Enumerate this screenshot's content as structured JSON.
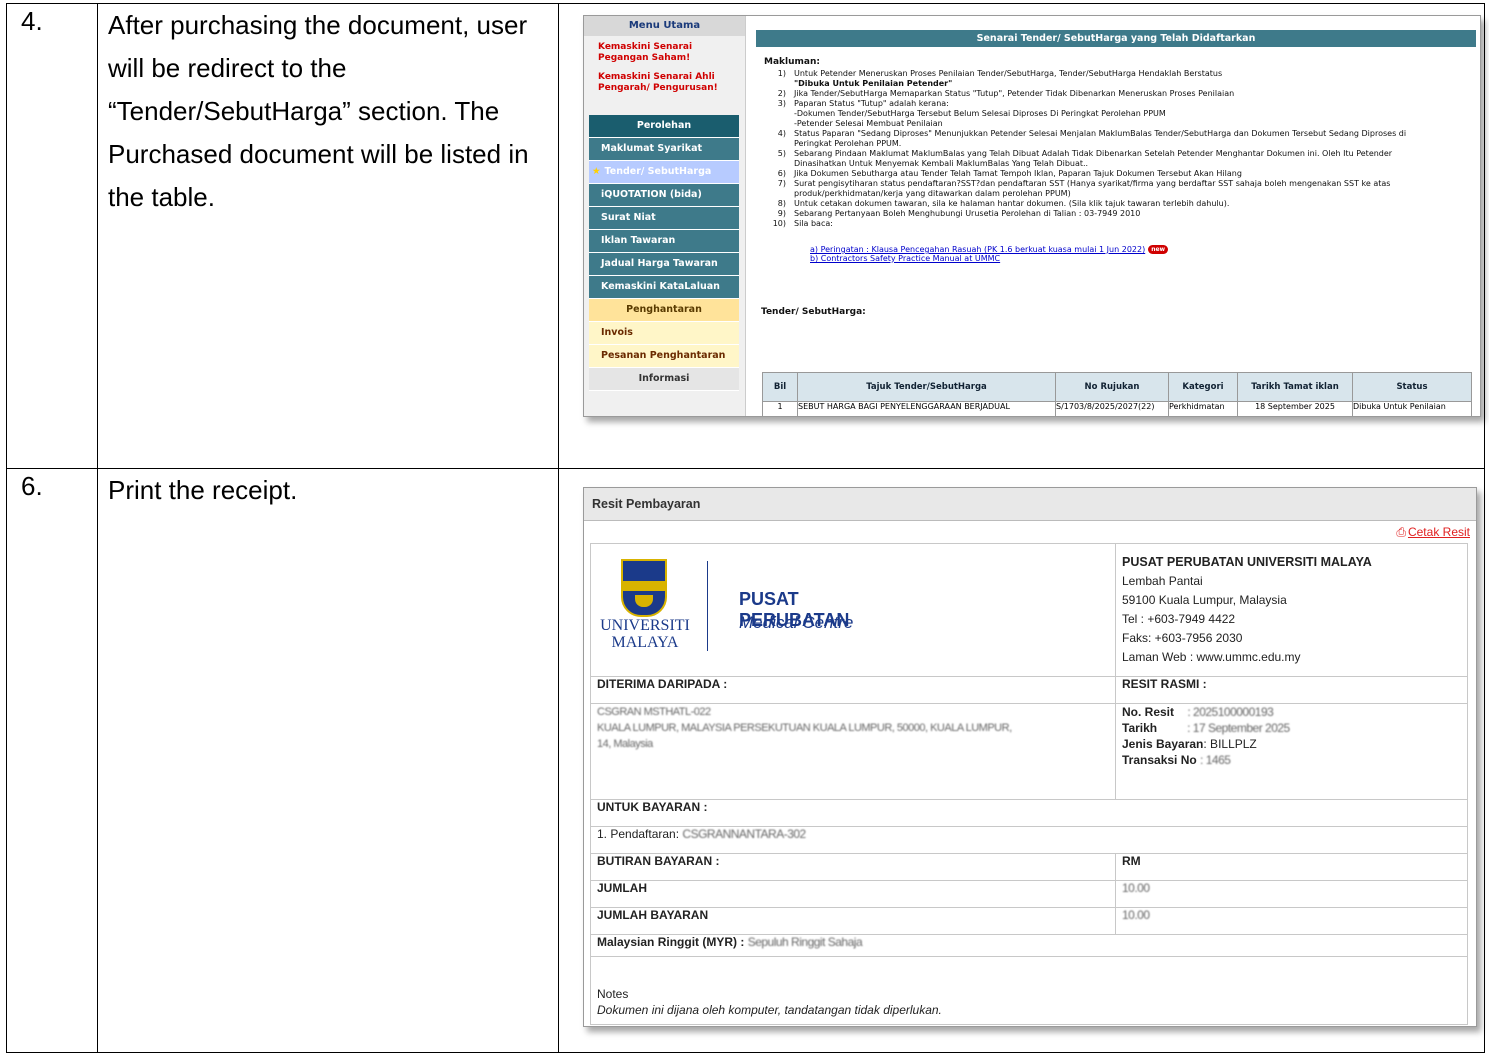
{
  "rows": [
    {
      "number": "4.",
      "text": "After purchasing the document, user will be redirect to the “Tender/SebutHarga” section. The Purchased document will be listed in the table."
    },
    {
      "number": "6.",
      "text": "Print the receipt."
    }
  ],
  "shot1": {
    "menu_title": "Menu Utama",
    "alerts": [
      "Kemaskini Senarai Pegangan Saham!",
      "Kemaskini Senarai Ahli Pengarah/ Pengurusan!"
    ],
    "nav": {
      "perolehan": "Perolehan",
      "items": [
        "Maklumat Syarikat",
        "Tender/ SebutHarga",
        "iQUOTATION (bida)",
        "Surat Niat",
        "Iklan Tawaran",
        "Jadual Harga Tawaran",
        "Kemaskini KataLaluan"
      ],
      "penghantaran": "Penghantaran",
      "penghantaran_items": [
        "Invois",
        "Pesanan Penghantaran"
      ],
      "informasi": "Informasi"
    },
    "banner": "Senarai Tender/ SebutHarga yang Telah Didaftarkan",
    "makluman_label": "Makluman:",
    "notes": [
      {
        "n": "1)",
        "t": "Untuk Petender Meneruskan Proses Penilaian Tender/SebutHarga, Tender/SebutHarga Hendaklah Berstatus",
        "b": "\"Dibuka Untuk Penilaian Petender\""
      },
      {
        "n": "2)",
        "t": "Jika Tender/SebutHarga Memaparkan Status \"Tutup\", Petender Tidak Dibenarkan Meneruskan Proses Penilaian"
      },
      {
        "n": "3)",
        "t": "Paparan Status \"Tutup\" adalah kerana:",
        "b": "-Dokumen Tender/SebutHarga Tersebut Belum Selesai Diproses Di Peringkat Perolehan PPUM",
        "c": "-Petender Selesai Membuat Penilaian"
      },
      {
        "n": "4)",
        "t": "Status Paparan \"Sedang Diproses\" Menunjukkan Petender Selesai Menjalan MaklumBalas Tender/SebutHarga dan Dokumen Tersebut Sedang Diproses di",
        "b": "Peringkat Perolehan PPUM."
      },
      {
        "n": "5)",
        "t": "Sebarang Pindaan Maklumat MaklumBalas yang Telah Dibuat Adalah Tidak Dibenarkan Setelah Petender Menghantar Dokumen ini. Oleh Itu Petender",
        "b": "Dinasihatkan Untuk Menyemak Kembali MaklumBalas Yang Telah Dibuat.."
      },
      {
        "n": "6)",
        "t": "Jika Dokumen Sebutharga atau Tender Telah Tamat Tempoh Iklan, Paparan Tajuk Dokumen Tersebut Akan Hilang"
      },
      {
        "n": "7)",
        "t": "Surat pengisytiharan status pendaftaran?SST?dan pendaftaran SST (Hanya syarikat/firma yang berdaftar SST sahaja boleh mengenakan SST ke atas",
        "b": "produk/perkhidmatan/kerja yang ditawarkan dalam perolehan PPUM)"
      },
      {
        "n": "8)",
        "t": "Untuk cetakan dokumen tawaran, sila ke halaman hantar dokumen. (Sila klik tajuk tawaran terlebih dahulu)."
      },
      {
        "n": "9)",
        "t": "Sebarang Pertanyaan Boleh Menghubungi Urusetia Perolehan di Talian : 03-7949 2010"
      },
      {
        "n": "10)",
        "t": "Sila baca:"
      }
    ],
    "link_a": "a) Peringatan : Klausa Pencegahan Rasuah (PK 1.6 berkuat kuasa mulai 1 Jun 2022)",
    "link_b": "b) Contractors Safety Practice Manual at UMMC",
    "new_badge": "new",
    "tender_heading": "Tender/ SebutHarga:",
    "table": {
      "headers": [
        "Bil",
        "Tajuk Tender/SebutHarga",
        "No Rujukan",
        "Kategori",
        "Tarikh Tamat iklan",
        "Status"
      ],
      "row": [
        "1",
        "SEBUT HARGA BAGI PENYELENGGARAAN BERJADUAL",
        "S/1703/8/2025/2027(22)",
        "Perkhidmatan",
        "18 September 2025",
        "Dibuka Untuk Penilaian"
      ]
    }
  },
  "shot2": {
    "title": "Resit Pembayaran",
    "print_label": "Cetak Resit",
    "logo_uni": "UNIVERSITI",
    "logo_malaya": "MALAYA",
    "logo_pp": "PUSAT PERUBATAN",
    "logo_mc": "Medical Centre",
    "org_name": "PUSAT PERUBATAN UNIVERSITI MALAYA",
    "addr1": "Lembah Pantai",
    "addr2": "59100 Kuala Lumpur, Malaysia",
    "tel": "Tel : +603-7949 4422",
    "fax": "Faks: +603-7956 2030",
    "web": "Laman Web : www.ummc.edu.my",
    "diterima": "DITERIMA DARIPADA :",
    "resit_rasmi": "RESIT RASMI :",
    "payer_line1": "CSGRAN MSTHATL-022",
    "payer_line2": "KUALA LUMPUR, MALAYSIA PERSEKUTUAN KUALA LUMPUR, 50000, KUALA LUMPUR,",
    "payer_line3": "14, Malaysia",
    "no_resit_label": "No. Resit",
    "no_resit_val": ": 2025100000193",
    "tarikh_label": "Tarikh",
    "tarikh_val": ": 17 September 2025",
    "jenis_label": "Jenis Bayaran",
    "jenis_val": ": BILLPLZ",
    "transaksi_label": "Transaksi No",
    "transaksi_val": ": 1465",
    "untuk_bayaran": "UNTUK BAYARAN :",
    "pendaftaran_label": "1. Pendaftaran:",
    "pendaftaran_val": "CSGRANNANTARA-302",
    "butiran": "BUTIRAN BAYARAN :",
    "rm": "RM",
    "jumlah": "JUMLAH",
    "jumlah_val": "10.00",
    "jumlah_bayaran": "JUMLAH BAYARAN",
    "jumlah_bayaran_val": "10.00",
    "myr_label": "Malaysian Ringgit (MYR) :",
    "myr_val": "Sepuluh Ringgit Sahaja",
    "notes_label": "Notes",
    "notes_text": "Dokumen ini dijana oleh komputer, tandatangan tidak diperlukan."
  }
}
